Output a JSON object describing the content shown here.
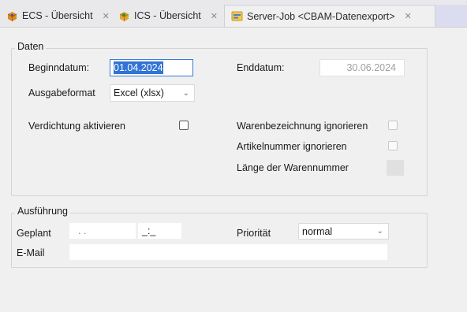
{
  "tabs": [
    {
      "label": "ECS - Übersicht",
      "icon": "ecs-app-icon",
      "close": "✕"
    },
    {
      "label": "ICS - Übersicht",
      "icon": "ics-app-icon",
      "close": "✕"
    },
    {
      "label": "Server-Job <CBAM-Datenexport>",
      "icon": "server-job-icon",
      "close": "✕",
      "active": true
    }
  ],
  "daten": {
    "title": "Daten",
    "beginndatum_label": "Beginndatum:",
    "beginndatum_value": "01.04.2024",
    "enddatum_label": "Enddatum:",
    "enddatum_value": "30.06.2024",
    "ausgabeformat_label": "Ausgabeformat",
    "ausgabeformat_value": "Excel (xlsx)",
    "verdichtung_label": "Verdichtung aktivieren",
    "warenbezeichnung_label": "Warenbezeichnung ignorieren",
    "artikelnummer_label": "Artikelnummer ignorieren",
    "laenge_label": "Länge der Warennummer"
  },
  "ausfuehrung": {
    "title": "Ausführung",
    "geplant_label": "Geplant",
    "geplant_date_value": ". .",
    "geplant_time_value": "_:_",
    "prioritaet_label": "Priorität",
    "prioritaet_value": "normal",
    "email_label": "E-Mail",
    "email_value": ""
  },
  "colors": {
    "accent": "#3173d6",
    "tab_bar": "#e9e9ec",
    "window_bg": "#f0f0f0"
  }
}
